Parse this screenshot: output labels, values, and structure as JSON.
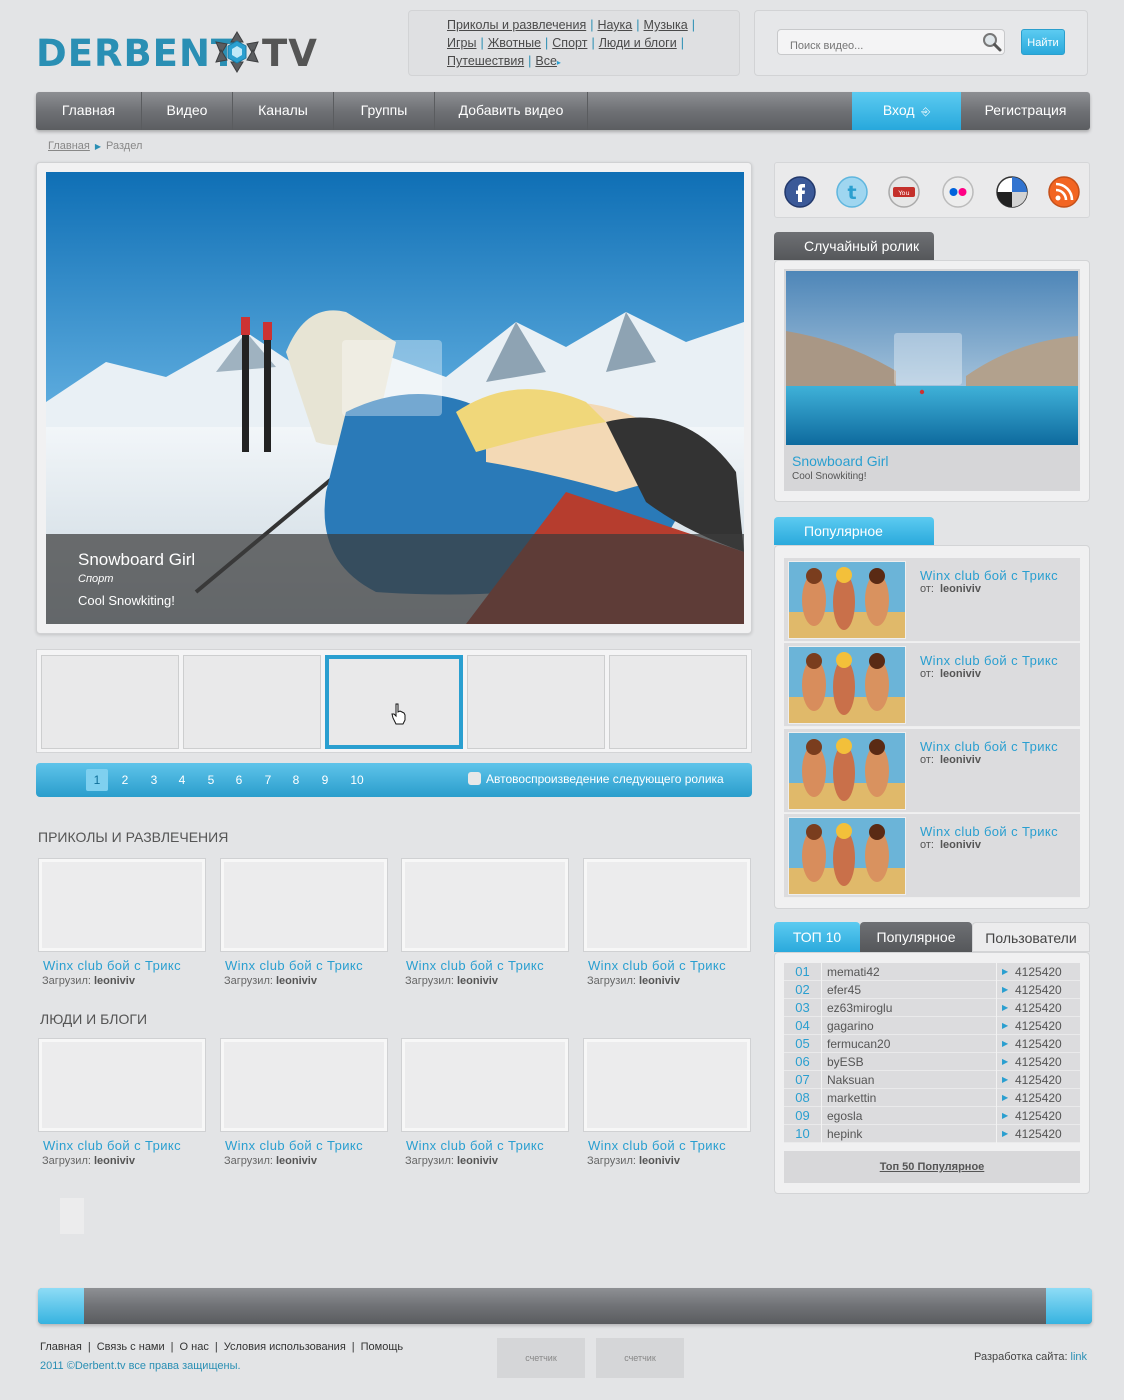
{
  "header": {
    "logo_left": "DERBENT",
    "logo_right": "TV",
    "categories": [
      [
        "Приколы и развлечения",
        "Наука",
        "Музыка"
      ],
      [
        "Игры",
        "Жвотные",
        "Спорт",
        "Люди и блоги"
      ],
      [
        "Путешествия",
        "Все"
      ]
    ],
    "search_placeholder": "Поиск видео...",
    "search_button": "Найти"
  },
  "nav": {
    "items": [
      "Главная",
      "Видео",
      "Каналы",
      "Группы",
      "Добавить видео"
    ],
    "login": "Вход",
    "register": "Регистрация"
  },
  "breadcrumb": {
    "home": "Главная",
    "current": "Раздел"
  },
  "feature": {
    "title": "Snowboard Girl",
    "category": "Спорт",
    "description": "Cool Snowkiting!"
  },
  "pager": {
    "pages": [
      "1",
      "2",
      "3",
      "4",
      "5",
      "6",
      "7",
      "8",
      "9",
      "10"
    ],
    "active": "1",
    "autoplay_label": "Автовоспроизведение следующего ролика"
  },
  "sections": [
    {
      "title": "ПРИКОЛЫ И РАЗВЛЕЧЕНИЯ",
      "videos": [
        {
          "title": "Winx club бой с Трикс",
          "by_label": "Загрузил:",
          "user": "leoniviv"
        },
        {
          "title": "Winx club бой с Трикс",
          "by_label": "Загрузил:",
          "user": "leoniviv"
        },
        {
          "title": "Winx club бой с Трикс",
          "by_label": "Загрузил:",
          "user": "leoniviv"
        },
        {
          "title": "Winx club бой с Трикс",
          "by_label": "Загрузил:",
          "user": "leoniviv"
        }
      ]
    },
    {
      "title": "ЛЮДИ И БЛОГИ",
      "videos": [
        {
          "title": "Winx club бой с Трикс",
          "by_label": "Загрузил:",
          "user": "leoniviv"
        },
        {
          "title": "Winx club бой с Трикс",
          "by_label": "Загрузил:",
          "user": "leoniviv"
        },
        {
          "title": "Winx club бой с Трикс",
          "by_label": "Загрузил:",
          "user": "leoniviv"
        },
        {
          "title": "Winx club бой с Трикс",
          "by_label": "Загрузил:",
          "user": "leoniviv"
        }
      ]
    }
  ],
  "sidebar": {
    "social": [
      "facebook-icon",
      "twitter-icon",
      "youtube-icon",
      "flickr-icon",
      "delicious-icon",
      "rss-icon"
    ],
    "random": {
      "heading": "Случайный ролик",
      "title": "Snowboard Girl",
      "description": "Cool Snowkiting!"
    },
    "popular": {
      "heading": "Популярное",
      "items": [
        {
          "title": "Winx club бой с Трикс",
          "by_label": "от:",
          "user": "leoniviv"
        },
        {
          "title": "Winx club бой с Трикс",
          "by_label": "от:",
          "user": "leoniviv"
        },
        {
          "title": "Winx club бой с Трикс",
          "by_label": "от:",
          "user": "leoniviv"
        },
        {
          "title": "Winx club бой с Трикс",
          "by_label": "от:",
          "user": "leoniviv"
        }
      ]
    },
    "top": {
      "tabs": [
        "ТОП 10",
        "Популярное",
        "Пользователи"
      ],
      "rows": [
        {
          "n": "01",
          "user": "memati42",
          "value": "4125420"
        },
        {
          "n": "02",
          "user": "efer45",
          "value": "4125420"
        },
        {
          "n": "03",
          "user": "ez63miroglu",
          "value": "4125420"
        },
        {
          "n": "04",
          "user": "gagarino",
          "value": "4125420"
        },
        {
          "n": "05",
          "user": "fermucan20",
          "value": "4125420"
        },
        {
          "n": "06",
          "user": "byESB",
          "value": "4125420"
        },
        {
          "n": "07",
          "user": "Naksuan",
          "value": "4125420"
        },
        {
          "n": "08",
          "user": "markettin",
          "value": "4125420"
        },
        {
          "n": "09",
          "user": "egosla",
          "value": "4125420"
        },
        {
          "n": "10",
          "user": "hepink",
          "value": "4125420"
        }
      ],
      "more": "Топ 50 Популярное"
    }
  },
  "footer": {
    "links": [
      "Главная",
      "Связь с нами",
      "О нас",
      "Условия использования",
      "Помощь"
    ],
    "copyright": "2011 ©Derbent.tv все права защищены.",
    "counters": [
      "счетчик",
      "счетчик"
    ],
    "dev_label": "Разработка сайта:",
    "dev_link": "link"
  },
  "colors": {
    "accent": "#2a9fd0",
    "nav": "#6f7175",
    "background": "#e3e4e6"
  }
}
